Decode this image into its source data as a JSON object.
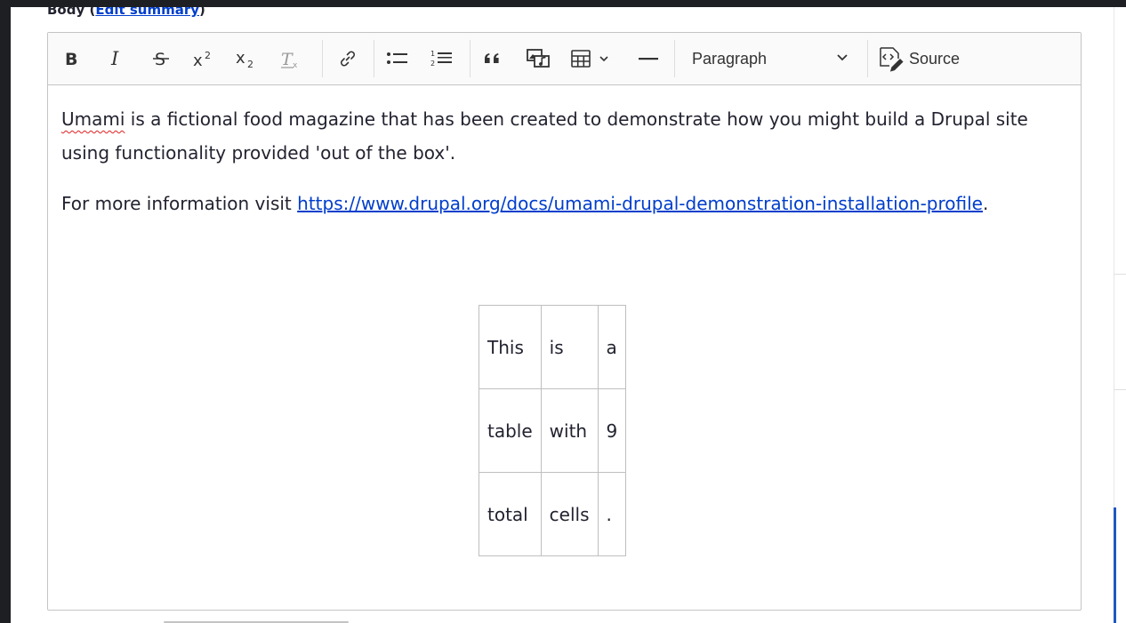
{
  "field": {
    "label": "Body",
    "open_paren": " (",
    "link_text": "Edit summary",
    "close_paren": ")"
  },
  "toolbar": {
    "buttons": [
      {
        "name": "bold",
        "glyph": "B"
      },
      {
        "name": "italic",
        "glyph": "I"
      },
      {
        "name": "strikethrough",
        "glyph": "S"
      },
      {
        "name": "superscript",
        "glyph": "X²"
      },
      {
        "name": "subscript",
        "glyph": "X₂"
      },
      {
        "name": "remove-format",
        "glyph": "T"
      },
      {
        "name": "link",
        "glyph": "link"
      },
      {
        "name": "bulleted-list",
        "glyph": "list"
      },
      {
        "name": "numbered-list",
        "glyph": "list"
      },
      {
        "name": "block-quote",
        "glyph": "quote"
      },
      {
        "name": "insert-media",
        "glyph": "media"
      },
      {
        "name": "insert-table",
        "glyph": "table"
      },
      {
        "name": "horizontal-line",
        "glyph": "line"
      }
    ],
    "heading_select": "Paragraph",
    "source_label": "Source"
  },
  "content": {
    "p1_spell": "Umami",
    "p1_rest": " is a fictional food magazine that has been created to demonstrate how you might build a Drupal site using functionality provided 'out of the box'.",
    "p2_text": "For more information visit ",
    "p2_link": "https://www.drupal.org/docs/umami-drupal-demonstration-installation-profile",
    "p2_end": ".",
    "table": [
      [
        "This",
        "is",
        "a"
      ],
      [
        "table",
        "with",
        "9"
      ],
      [
        "total",
        "cells",
        "."
      ]
    ]
  },
  "colors": {
    "link": "#003ecc",
    "spellcheck": "#e02020",
    "accent": "#1f57c2"
  }
}
